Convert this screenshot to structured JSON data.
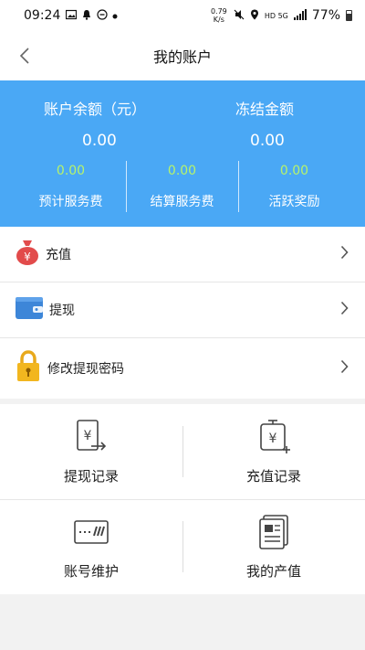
{
  "status_bar": {
    "time": "09:24",
    "speed": "0.79 K/s",
    "network": "HD 5G",
    "battery": "77%"
  },
  "header": {
    "title": "我的账户"
  },
  "account": {
    "balance_label": "账户余额（元）",
    "balance_value": "0.00",
    "frozen_label": "冻结金额",
    "frozen_value": "0.00",
    "stats": [
      {
        "value": "0.00",
        "label": "预计服务费"
      },
      {
        "value": "0.00",
        "label": "结算服务费"
      },
      {
        "value": "0.00",
        "label": "活跃奖励"
      }
    ]
  },
  "menu": {
    "items": [
      {
        "label": "充值",
        "icon": "money-bag-icon"
      },
      {
        "label": "提现",
        "icon": "wallet-icon"
      },
      {
        "label": "修改提现密码",
        "icon": "lock-icon"
      }
    ]
  },
  "grid": {
    "items": [
      {
        "label": "提现记录",
        "icon": "withdraw-record-icon"
      },
      {
        "label": "充值记录",
        "icon": "recharge-record-icon"
      },
      {
        "label": "账号维护",
        "icon": "bank-card-icon"
      },
      {
        "label": "我的产值",
        "icon": "document-icon"
      }
    ]
  },
  "colors": {
    "banner": "#4aa8f5",
    "stat_value": "#b6f36b"
  }
}
